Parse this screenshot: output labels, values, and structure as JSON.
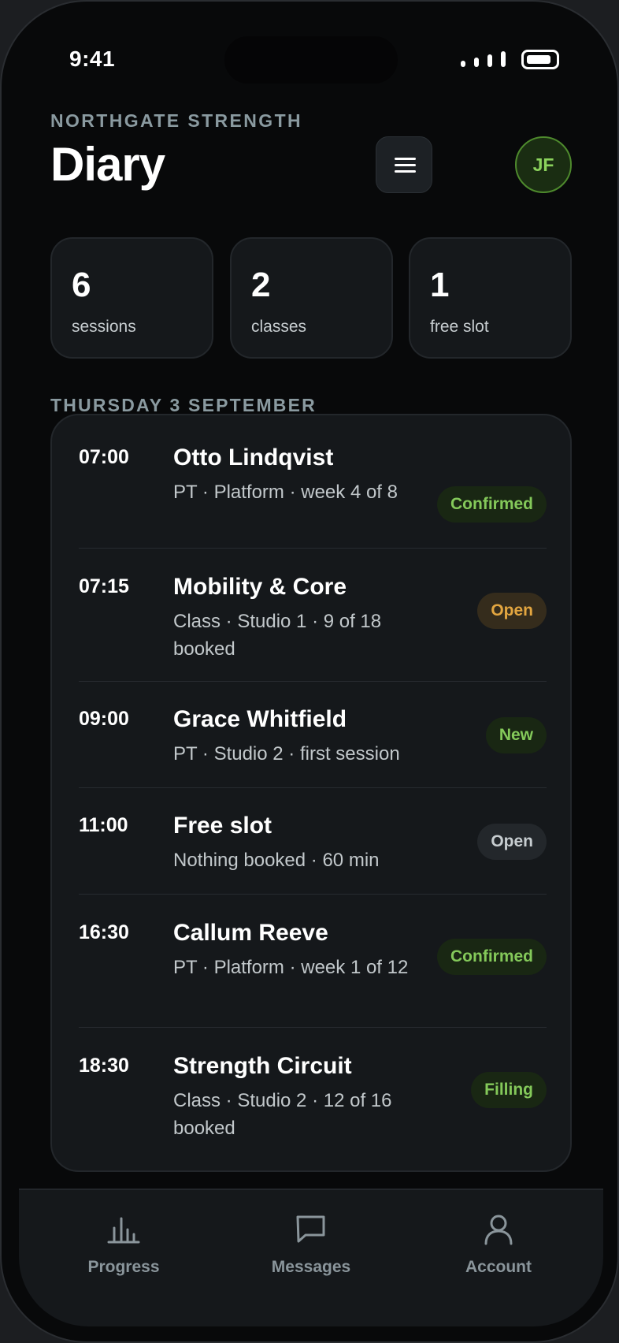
{
  "status_bar": {
    "time": "9:41"
  },
  "header": {
    "eyebrow": "NORTHGATE STRENGTH",
    "title": "Diary",
    "avatar_initials": "JF"
  },
  "stats": [
    {
      "value": "6",
      "label": "sessions"
    },
    {
      "value": "2",
      "label": "classes"
    },
    {
      "value": "1",
      "label": "free slot"
    }
  ],
  "day": {
    "label": "THURSDAY 3 SEPTEMBER"
  },
  "agenda": [
    {
      "time": "07:00",
      "title": "Otto Lindqvist",
      "subtitle": "PT · Platform · week 4 of 8",
      "badge": "Confirmed",
      "badge_style": "green"
    },
    {
      "time": "07:15",
      "title": "Mobility & Core",
      "subtitle": "Class · Studio 1 · 9 of 18 booked",
      "badge": "Open",
      "badge_style": "amber"
    },
    {
      "time": "09:00",
      "title": "Grace Whitfield",
      "subtitle": "PT · Studio 2 · first session",
      "badge": "New",
      "badge_style": "green"
    },
    {
      "time": "11:00",
      "title": "Free slot",
      "subtitle": "Nothing booked · 60 min",
      "badge": "Open",
      "badge_style": "grey"
    },
    {
      "time": "16:30",
      "title": "Callum Reeve",
      "subtitle": "PT · Platform · week 1 of 12",
      "badge": "Confirmed",
      "badge_style": "green"
    },
    {
      "time": "18:30",
      "title": "Strength Circuit",
      "subtitle": "Class · Studio 2 · 12 of 16 booked",
      "badge": "Filling",
      "badge_style": "green"
    }
  ],
  "tabbar": {
    "items": [
      {
        "label": "Progress",
        "icon": "bar-chart-icon"
      },
      {
        "label": "Messages",
        "icon": "message-icon"
      },
      {
        "label": "Account",
        "icon": "person-icon"
      }
    ]
  },
  "colors": {
    "background": "#08090a",
    "card": "#15181b",
    "accent_green": "#84c95a",
    "accent_amber": "#e3a640",
    "muted_text": "#8a9aa0"
  }
}
